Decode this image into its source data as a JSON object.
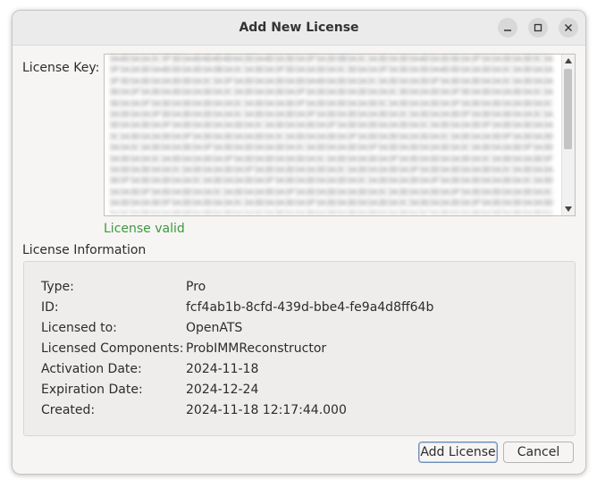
{
  "window": {
    "title": "Add New License"
  },
  "license_key": {
    "label": "License Key:",
    "value_obscured": "3A4D3A3A3C3F3D3A4D4D4D4D4A3D3A4D3A3D3A3F3A3D3B3A3C3A3D3A3D3A4D3A3D3D3A3F3A3A3D3A3D3C3A3F3A3A3D3A4D3D3A3D3A3B3A3C3A3D3A3F3D3A3A3D3A3C3D3A3A3F3A3D3A3D3A4D3D3A3A3D3A3C3A3D3A3A3F3D3A3D3A3A3D3D3A3C3A3F3A3D3A3A3D3A3D3A4D3A3D3A3A3C3A3D3A3A3D3F3A3D3A3D3A3A3C3A3D3A3A3D3A3F3A3D3A3D3A3A3D3A3C3A3D3A3A3D3A3F3A3D3A3D3A3D3A3A3C3D3A3A3D3A3F3D3A3D3A3A3D3A3C3A3D3A3A3F3A3D3A3D3A3D3A3A3C3A3D3A3A3D3F3A3D3A3D3A3A3D3C3A3D3A3A3D3A3F3A3D3A3D3A3A3D3A3C3A3D3A3A3F3D3A3D3A3D3A3A3C3A3D3A3A3D3A3F3A3D3A3D3A3A3D3A3C3A3D3A3A3D3F3A3D3A3D3A3A3C3A3D3A3A3D3A3F3A3D3A3D3A3A3D3A3C3A3D3A3A3D3A3F3A3D3A3D3A3A3D3A3C3A3D3A3A3D3F3A3D3A3D3A3A3C3A3D3A3A3D3A3F3A3D3A3D3A3A3D3A3C3A3D3A3A3D3A3F3A3D3A3D3A3A3D3A3C3A3D3A3A3D3F3A3D3A3D3A3A3C3A3D3A3A3D3A3F3A3D3A3D3A3A3D3A3C3A3D3A3A3D3A3F3A3D3A3D3A3A3D3A3C3A3D3A3A3D3F3A3D3A3D3A3A3C3A3D3A3A3D3A3F3A3D3A3D3A3A3D3A3C3A3D3A3A3D3A3F3A3D3A3D3A3A3D3A3C3A3D3A3A3D3F3A3D3A3D3A3A3C3A3D3A3A3D3A3F3A3D3A3D3A3A3D3A3C3A3D3A3A3D3A3F3A3D3A3D3A3A3D3A3C3A3D3A3A3D3F3A3D3A3D3A3A3C3A3D3A3A3D3A3F3A3D3A3D3A3A3D3A3C3A3D3A3A3D3A3F3A3D3A3D3A3A3D3A3C3A3D3A3A3D3F3A3D3A3D3A3A3C3A3D3A3A3D3A3F3A3D3A3D3A3A3D3A3C3A3D3A3A3D3A3F3A3D3A3D3A3A3D3A3C3A3D3A3A3D3F3A3D3A3D3A3A3C3A3D3A3A3D3A3F3A3D3A3D3A3A3D3A3C3A3D3A3A3D3A3F3A3D3A3D3A3A3D3A3C3A3D3A3A3D3F3A3D3A3D3A3A3C3A3D3A3A3D3A3F3A3D3A3D3A3A3D3A3C3A3D3A3A3D3A3F3A3D3A3D3A3A3D3A3C3A3D3A3A3D3F3A3D3A3D3A3A3C3A3D3A3A3D3A3F3A3D3A3D3A3A3D3A3C3A3D3A3A3D3A3F3A3D3A3D3A3A3D3A3C3A3D3A3A3D3F3A3D3A3D3A3A3C3A3D3A3A3D3A3F3A3D3A3D3A3A3D3A3C3A3D3A3A3D3A3F3A3D3A3D3A3A3D3A3C3A3D3A3A3D3F3A3D3A3D3A3A3C3A3D3A3A3D3A3F3A3D3A3D3A3A3D3A3C3A3D3A3A3D3A3F3A3D3A3D3A3A3D3A3C3A3D3A3A3D3F",
    "status": "License valid",
    "status_color": "#3c9a3c"
  },
  "license_information": {
    "title": "License Information",
    "rows": [
      {
        "key": "Type:",
        "value": "Pro"
      },
      {
        "key": "ID:",
        "value": "fcf4ab1b-8cfd-439d-bbe4-fe9a4d8ff64b"
      },
      {
        "key": "Licensed to:",
        "value": "OpenATS"
      },
      {
        "key": "Licensed Components:",
        "value": "ProbIMMReconstructor"
      },
      {
        "key": "Activation Date:",
        "value": "2024-11-18"
      },
      {
        "key": "Expiration Date:",
        "value": "2024-12-24"
      },
      {
        "key": "Created:",
        "value": "2024-11-18 12:17:44.000"
      }
    ]
  },
  "buttons": {
    "add_license": "Add License",
    "cancel": "Cancel"
  },
  "icons": {
    "minimize": "minimize-icon",
    "maximize": "maximize-icon",
    "close": "close-icon",
    "scroll_up": "scroll-up-arrow-icon",
    "scroll_down": "scroll-down-arrow-icon"
  }
}
